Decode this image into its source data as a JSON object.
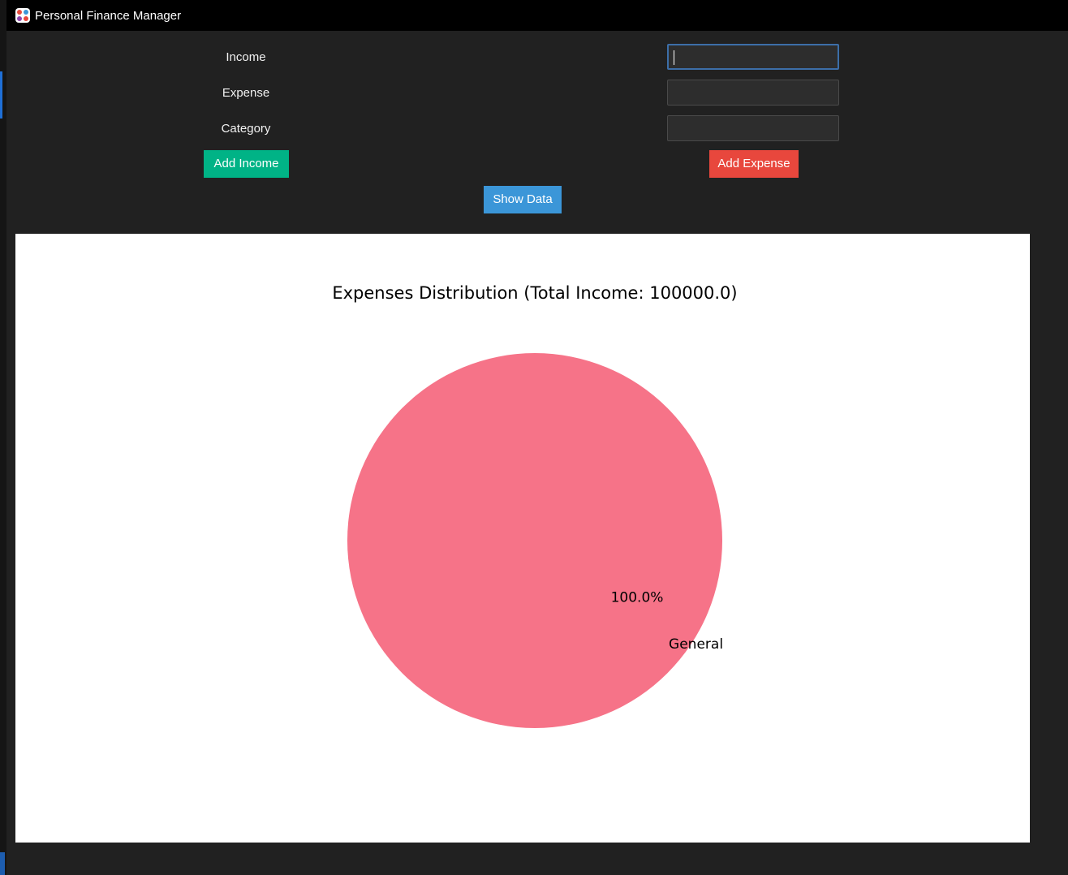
{
  "window": {
    "title": "Personal Finance Manager",
    "icon": "app-grid-icon"
  },
  "form": {
    "income_label": "Income",
    "expense_label": "Expense",
    "category_label": "Category",
    "income_value": "",
    "expense_value": "",
    "category_value": ""
  },
  "buttons": {
    "add_income": "Add Income",
    "add_expense": "Add Expense",
    "show_data": "Show Data"
  },
  "colors": {
    "add_income": "#00b386",
    "add_expense": "#e8473d",
    "show_data": "#3b96d8",
    "pie_general": "#f67388"
  },
  "chart_data": {
    "type": "pie",
    "title": "Expenses Distribution (Total Income: 100000.0)",
    "slices": [
      {
        "label": "General",
        "percent": 100.0,
        "percent_label": "100.0%",
        "color": "#f67388"
      }
    ]
  }
}
